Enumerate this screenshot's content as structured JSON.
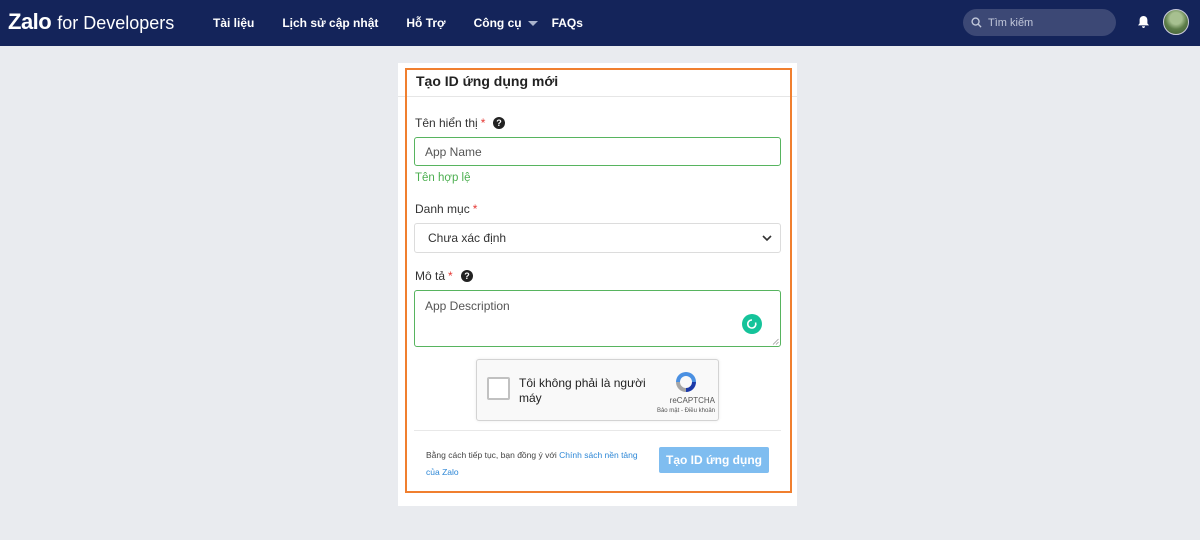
{
  "header": {
    "brand_name": "Zalo",
    "brand_suffix": "for Developers",
    "nav": {
      "docs": "Tài liệu",
      "changelog": "Lịch sử cập nhật",
      "support": "Hỗ Trợ",
      "tools": "Công cụ",
      "faqs": "FAQs"
    },
    "search_placeholder": "Tìm kiếm"
  },
  "form": {
    "title": "Tạo ID ứng dụng mới",
    "name_label": "Tên hiển thị",
    "name_placeholder": "App Name",
    "name_valid_message": "Tên hợp lệ",
    "category_label": "Danh mục",
    "category_value": "Chưa xác định",
    "description_label": "Mô tả",
    "description_placeholder": "App Description",
    "required_mark": "*",
    "captcha": {
      "checkbox_text": "Tôi không phải là người máy",
      "brand": "reCAPTCHA",
      "links": "Bảo mật - Điều khoản"
    },
    "terms_prefix": "Bằng cách tiếp tục, bạn đồng ý với",
    "terms_link": "Chính sách nền tảng của Zalo",
    "submit_label": "Tạo ID ứng dụng"
  },
  "colors": {
    "nav_background": "#14245a",
    "highlight_border": "#f07f2f",
    "valid_green": "#4caf50",
    "submit_button": "#7fbdf0",
    "link_blue": "#2d87d6"
  }
}
